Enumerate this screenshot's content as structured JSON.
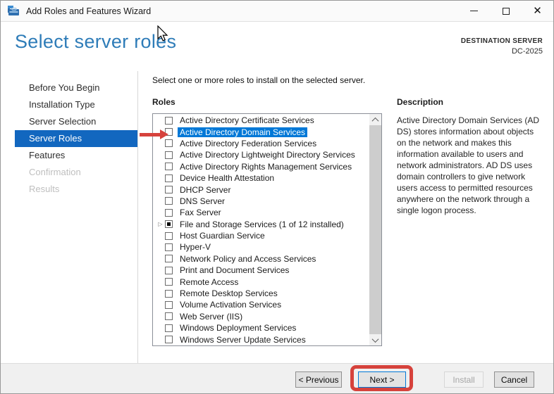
{
  "window": {
    "title": "Add Roles and Features Wizard",
    "controls": [
      {
        "name": "minimize"
      },
      {
        "name": "maximize"
      },
      {
        "name": "close"
      }
    ]
  },
  "header": {
    "title": "Select server roles",
    "destination_label": "DESTINATION SERVER",
    "destination_server": "DC-2025"
  },
  "sidebar": {
    "items": [
      {
        "label": "Before You Begin",
        "state": "normal"
      },
      {
        "label": "Installation Type",
        "state": "normal"
      },
      {
        "label": "Server Selection",
        "state": "normal"
      },
      {
        "label": "Server Roles",
        "state": "selected"
      },
      {
        "label": "Features",
        "state": "normal"
      },
      {
        "label": "Confirmation",
        "state": "disabled"
      },
      {
        "label": "Results",
        "state": "disabled"
      }
    ]
  },
  "main": {
    "intro": "Select one or more roles to install on the selected server.",
    "roles_label": "Roles",
    "roles": [
      {
        "label": "Active Directory Certificate Services",
        "checkbox": "unchecked",
        "selected": false,
        "expandable": false
      },
      {
        "label": "Active Directory Domain Services",
        "checkbox": "unchecked",
        "selected": true,
        "expandable": false
      },
      {
        "label": "Active Directory Federation Services",
        "checkbox": "unchecked",
        "selected": false,
        "expandable": false
      },
      {
        "label": "Active Directory Lightweight Directory Services",
        "checkbox": "unchecked",
        "selected": false,
        "expandable": false
      },
      {
        "label": "Active Directory Rights Management Services",
        "checkbox": "unchecked",
        "selected": false,
        "expandable": false
      },
      {
        "label": "Device Health Attestation",
        "checkbox": "unchecked",
        "selected": false,
        "expandable": false
      },
      {
        "label": "DHCP Server",
        "checkbox": "unchecked",
        "selected": false,
        "expandable": false
      },
      {
        "label": "DNS Server",
        "checkbox": "unchecked",
        "selected": false,
        "expandable": false
      },
      {
        "label": "Fax Server",
        "checkbox": "unchecked",
        "selected": false,
        "expandable": false
      },
      {
        "label": "File and Storage Services (1 of 12 installed)",
        "checkbox": "mixed",
        "selected": false,
        "expandable": true
      },
      {
        "label": "Host Guardian Service",
        "checkbox": "unchecked",
        "selected": false,
        "expandable": false
      },
      {
        "label": "Hyper-V",
        "checkbox": "unchecked",
        "selected": false,
        "expandable": false
      },
      {
        "label": "Network Policy and Access Services",
        "checkbox": "unchecked",
        "selected": false,
        "expandable": false
      },
      {
        "label": "Print and Document Services",
        "checkbox": "unchecked",
        "selected": false,
        "expandable": false
      },
      {
        "label": "Remote Access",
        "checkbox": "unchecked",
        "selected": false,
        "expandable": false
      },
      {
        "label": "Remote Desktop Services",
        "checkbox": "unchecked",
        "selected": false,
        "expandable": false
      },
      {
        "label": "Volume Activation Services",
        "checkbox": "unchecked",
        "selected": false,
        "expandable": false
      },
      {
        "label": "Web Server (IIS)",
        "checkbox": "unchecked",
        "selected": false,
        "expandable": false
      },
      {
        "label": "Windows Deployment Services",
        "checkbox": "unchecked",
        "selected": false,
        "expandable": false
      },
      {
        "label": "Windows Server Update Services",
        "checkbox": "unchecked",
        "selected": false,
        "expandable": false
      }
    ]
  },
  "description": {
    "heading": "Description",
    "text": "Active Directory Domain Services (AD DS) stores information about objects on the network and makes this information available to users and network administrators. AD DS uses domain controllers to give network users access to permitted resources anywhere on the network through a single logon process."
  },
  "footer": {
    "buttons": [
      {
        "label": "< Previous",
        "style": "prev",
        "enabled": true
      },
      {
        "label": "Next >",
        "style": "next",
        "enabled": true,
        "annotated": true
      },
      {
        "label": "Install",
        "style": "install",
        "enabled": false
      },
      {
        "label": "Cancel",
        "style": "cancel",
        "enabled": true
      }
    ]
  },
  "colors": {
    "accent_blue": "#0078d7",
    "sidebar_selected_blue": "#1267bf",
    "title_blue": "#2e7cb8",
    "annotation_red": "#d6423c"
  }
}
